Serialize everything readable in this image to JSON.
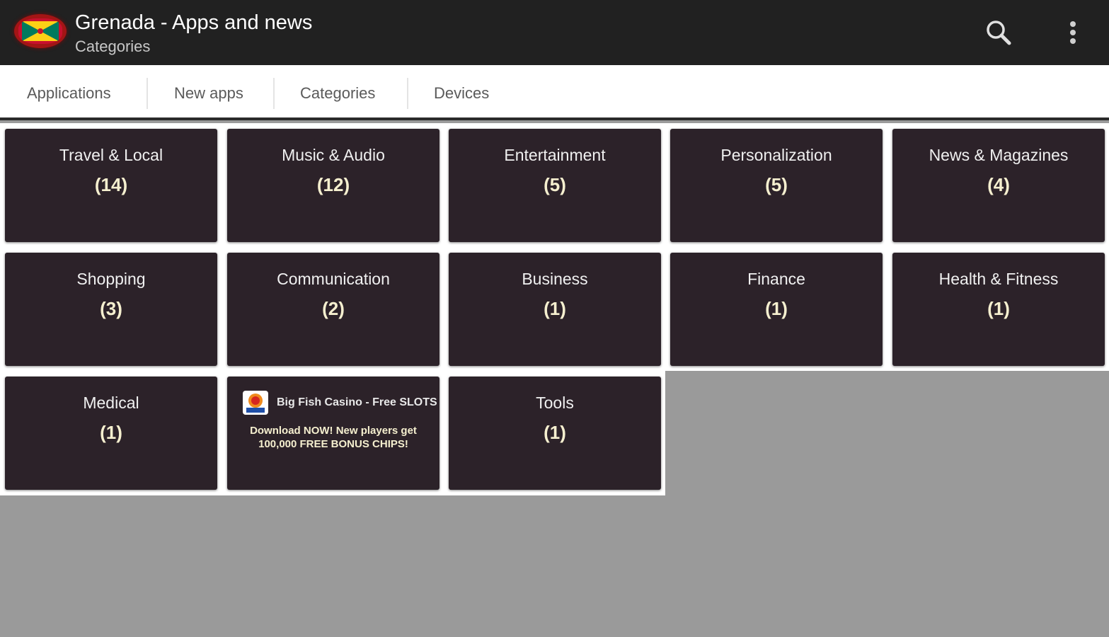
{
  "appbar": {
    "title": "Grenada - Apps and news",
    "subtitle": "Categories",
    "icons": [
      "grenada-flag-icon",
      "search-icon",
      "overflow-menu-icon"
    ],
    "background_color": "#212121"
  },
  "tabs": [
    {
      "label": "Applications"
    },
    {
      "label": "New apps"
    },
    {
      "label": "Categories"
    },
    {
      "label": "Devices"
    }
  ],
  "categories": [
    {
      "name": "Travel & Local",
      "count": "(14)"
    },
    {
      "name": "Music & Audio",
      "count": "(12)"
    },
    {
      "name": "Entertainment",
      "count": "(5)"
    },
    {
      "name": "Personalization",
      "count": "(5)"
    },
    {
      "name": "News & Magazines",
      "count": "(4)"
    },
    {
      "name": "Shopping",
      "count": "(3)"
    },
    {
      "name": "Communication",
      "count": "(2)"
    },
    {
      "name": "Business",
      "count": "(1)"
    },
    {
      "name": "Finance",
      "count": "(1)"
    },
    {
      "name": "Health & Fitness",
      "count": "(1)"
    },
    {
      "name": "Medical",
      "count": "(1)"
    },
    {
      "name": "Tools",
      "count": "(1)"
    }
  ],
  "ad": {
    "title": "Big Fish Casino - Free SLOTS",
    "description": "Download NOW! New players get 100,000 FREE BONUS CHIPS!",
    "icon": "casino-app-icon"
  },
  "colors": {
    "tile_background": "#2c2229",
    "count_text": "#f5efcf",
    "page_background": "#9a9a9a"
  }
}
